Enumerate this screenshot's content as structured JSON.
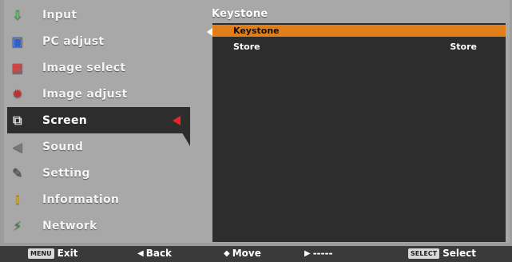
{
  "menu": {
    "items": [
      {
        "label": "Input",
        "icon": "input-icon",
        "glyph": "⇩",
        "color": "#4caf50",
        "active": false
      },
      {
        "label": "PC adjust",
        "icon": "pc-adjust-icon",
        "glyph": "▣",
        "color": "#2f5fd0",
        "active": false
      },
      {
        "label": "Image select",
        "icon": "image-select-icon",
        "glyph": "▦",
        "color": "#d04040",
        "active": false
      },
      {
        "label": "Image adjust",
        "icon": "image-adjust-icon",
        "glyph": "✹",
        "color": "#c03030",
        "active": false
      },
      {
        "label": "Screen",
        "icon": "screen-icon",
        "glyph": "⧉",
        "color": "#dddddd",
        "active": true
      },
      {
        "label": "Sound",
        "icon": "sound-icon",
        "glyph": "◀",
        "color": "#777777",
        "active": false
      },
      {
        "label": "Setting",
        "icon": "setting-icon",
        "glyph": "✎",
        "color": "#444444",
        "active": false
      },
      {
        "label": "Information",
        "icon": "information-icon",
        "glyph": "i",
        "color": "#d0a020",
        "active": false
      },
      {
        "label": "Network",
        "icon": "network-icon",
        "glyph": "⚡",
        "color": "#3a8c3a",
        "active": false
      }
    ]
  },
  "panel": {
    "title": "Keystone",
    "rows": [
      {
        "label": "Keystone",
        "value": "",
        "selected": true
      },
      {
        "label": "Store",
        "value": "Store",
        "selected": false
      }
    ]
  },
  "bottombar": {
    "exit_key": "MENU",
    "exit_label": "Exit",
    "back_label": "Back",
    "move_label": "Move",
    "next_label": "-----",
    "select_key": "SELECT",
    "select_label": "Select"
  },
  "colors": {
    "accent_selected": "#e07f1a",
    "active_arrow": "#e8262a"
  }
}
